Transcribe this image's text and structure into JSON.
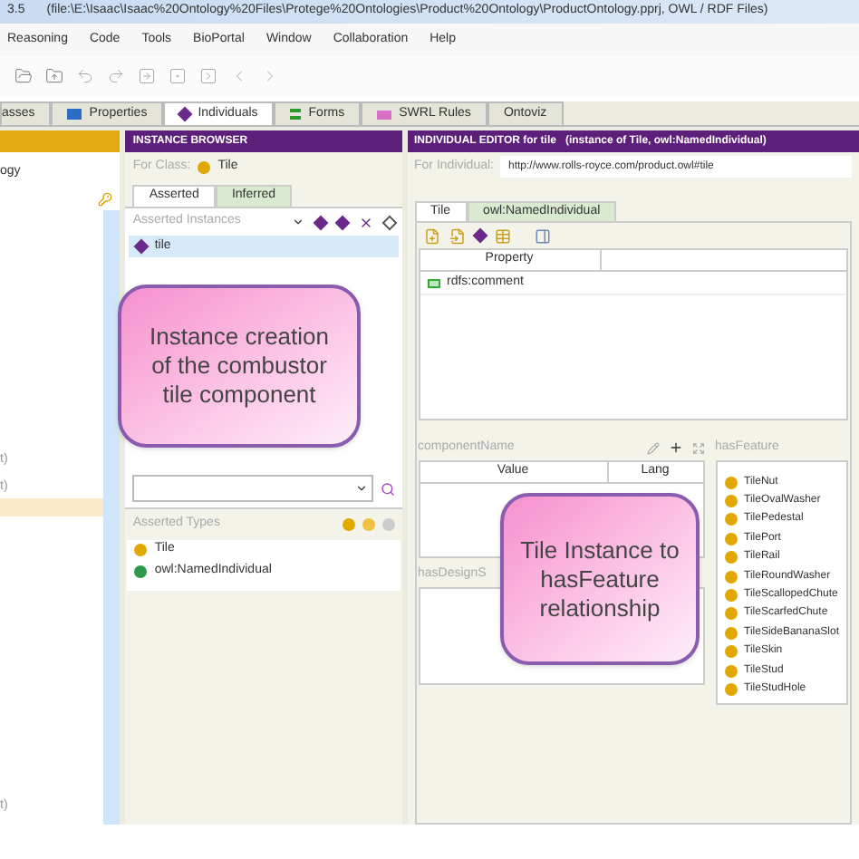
{
  "title_bar": {
    "version": "3.5",
    "path": "(file:\\E:\\Isaac\\Isaac%20Ontology%20Files\\Protege%20Ontologies\\Product%20Ontology\\ProductOntology.pprj, OWL / RDF Files)"
  },
  "menu": [
    "Reasoning",
    "Code",
    "Tools",
    "BioPortal",
    "Window",
    "Collaboration",
    "Help"
  ],
  "tabs": [
    {
      "label": "asses",
      "selected": false,
      "kind": "plain"
    },
    {
      "label": "Properties",
      "selected": false,
      "kind": "property"
    },
    {
      "label": "Individuals",
      "selected": true,
      "kind": "individual"
    },
    {
      "label": "Forms",
      "selected": false,
      "kind": "form"
    },
    {
      "label": "SWRL Rules",
      "selected": false,
      "kind": "rule"
    },
    {
      "label": "Ontoviz",
      "selected": false,
      "kind": "plain"
    }
  ],
  "left_panel": {
    "title_fragment": "ogy",
    "row_fragments": [
      "t)",
      "t)",
      "t)"
    ]
  },
  "instance_browser": {
    "title": "INSTANCE BROWSER",
    "for_class_label": "For Class:",
    "for_class": "Tile",
    "tabs": [
      {
        "label": "Asserted",
        "selected": true
      },
      {
        "label": "Inferred",
        "selected": false
      }
    ],
    "list_title": "Asserted Instances",
    "instances": [
      {
        "name": "tile",
        "selected": true
      }
    ],
    "types_title": "Asserted Types",
    "types": [
      {
        "name": "Tile",
        "kind": "class"
      },
      {
        "name": "owl:NamedIndividual",
        "kind": "builtin"
      }
    ]
  },
  "individual_editor": {
    "title": "INDIVIDUAL EDITOR for tile   (instance of Tile, owl:NamedIndividual)",
    "for_individual_label": "For Individual:",
    "iri": "http://www.rolls-royce.com/product.owl#tile",
    "tabs": [
      {
        "label": "Tile",
        "selected": true
      },
      {
        "label": "owl:NamedIndividual",
        "selected": false
      }
    ],
    "property_column": "Property",
    "properties": [
      "rdfs:comment"
    ],
    "component_name": {
      "title": "componentName",
      "columns": [
        "Value",
        "Lang"
      ]
    },
    "has_design_title": "hasDesignS",
    "has_feature": {
      "title": "hasFeature",
      "items": [
        "TileNut",
        "TileOvalWasher",
        "TilePedestal",
        "TilePort",
        "TileRail",
        "TileRoundWasher",
        "TileScallopedChute",
        "TileScarfedChute",
        "TileSideBananaSlot",
        "TileSkin",
        "TileStud",
        "TileStudHole"
      ]
    }
  },
  "callouts": [
    "Instance creation of the combustor tile component",
    "Tile Instance to hasFeature relationship"
  ]
}
